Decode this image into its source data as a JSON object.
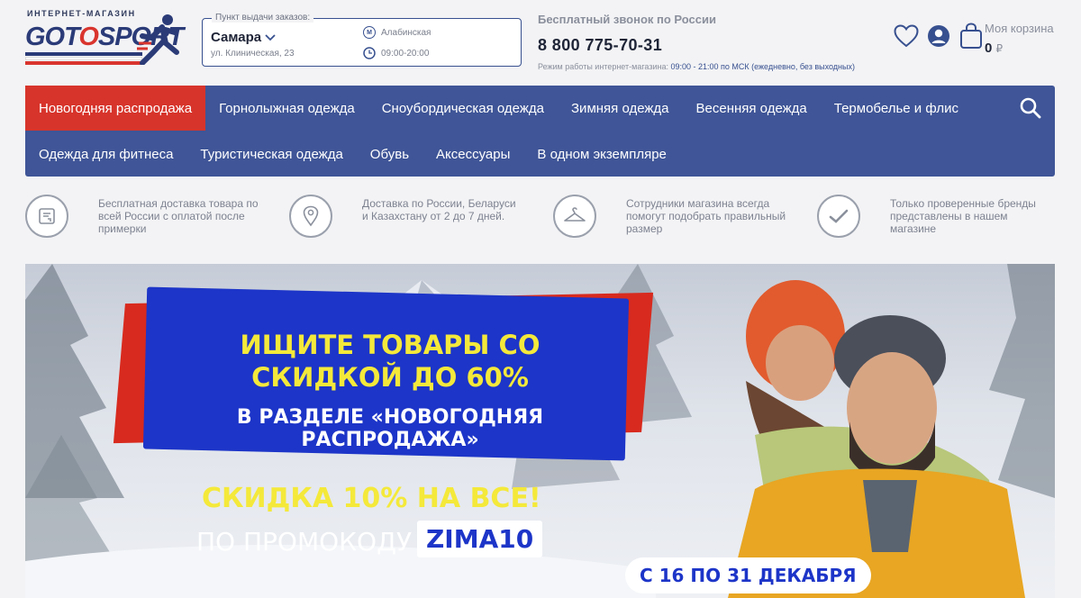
{
  "logo": {
    "tagline": "ИНТЕРНЕТ-МАГАЗИН",
    "name_part1": "GOT",
    "name_part2": "O",
    "name_part3": "SPORT"
  },
  "pickup": {
    "legend": "Пункт выдачи заказов:",
    "city": "Самара",
    "address": "ул. Клиническая, 23",
    "metro": "Алабинская",
    "hours": "09:00-20:00"
  },
  "call": {
    "title": "Бесплатный звонок по России",
    "phone": "8 800 775-70-31",
    "mode_label": "Режим работы интернет-магазина:",
    "mode_value": "09:00 - 21:00 по МСК (ежедневно, без выходных)"
  },
  "cart": {
    "label": "Моя корзина",
    "sum": "0",
    "currency": "₽"
  },
  "nav": {
    "row1": [
      "Новогодняя распродажа",
      "Горнолыжная одежда",
      "Сноубордическая одежда",
      "Зимняя одежда",
      "Весенняя одежда",
      "Термобелье и флис"
    ],
    "row2": [
      "Одежда для фитнеса",
      "Туристическая одежда",
      "Обувь",
      "Аксессуары",
      "В одном экземпляре"
    ]
  },
  "benefits": [
    {
      "icon": "delivery-box-icon",
      "text": "Бесплатная доставка товара по всей России с оплатой после примерки"
    },
    {
      "icon": "location-pin-icon",
      "text": "Доставка по России, Беларуси и Казахстану от 2 до 7 дней."
    },
    {
      "icon": "hanger-icon",
      "text": "Сотрудники магазина всегда помогут подобрать правильный размер"
    },
    {
      "icon": "checkmark-icon",
      "text": "Только проверенные бренды представлены в нашем магазине"
    }
  ],
  "banner": {
    "line1": "ИЩИТЕ ТОВАРЫ СО",
    "line2": "СКИДКОЙ ДО 60%",
    "line3": "В РАЗДЕЛЕ «НОВОГОДНЯЯ РАСПРОДАЖА»",
    "discount": "СКИДКА 10% НА ВСЕ!",
    "code_label": "ПО ПРОМОКОДУ",
    "code": "ZIMA10",
    "dates": "С 16 ПО 31 ДЕКАБРЯ"
  },
  "colors": {
    "nav_bg": "#3f5597",
    "nav_active": "#d7342b",
    "promo_blue": "#1d35c8",
    "promo_yellow": "#f4e93a",
    "promo_red": "#d82a1e"
  }
}
